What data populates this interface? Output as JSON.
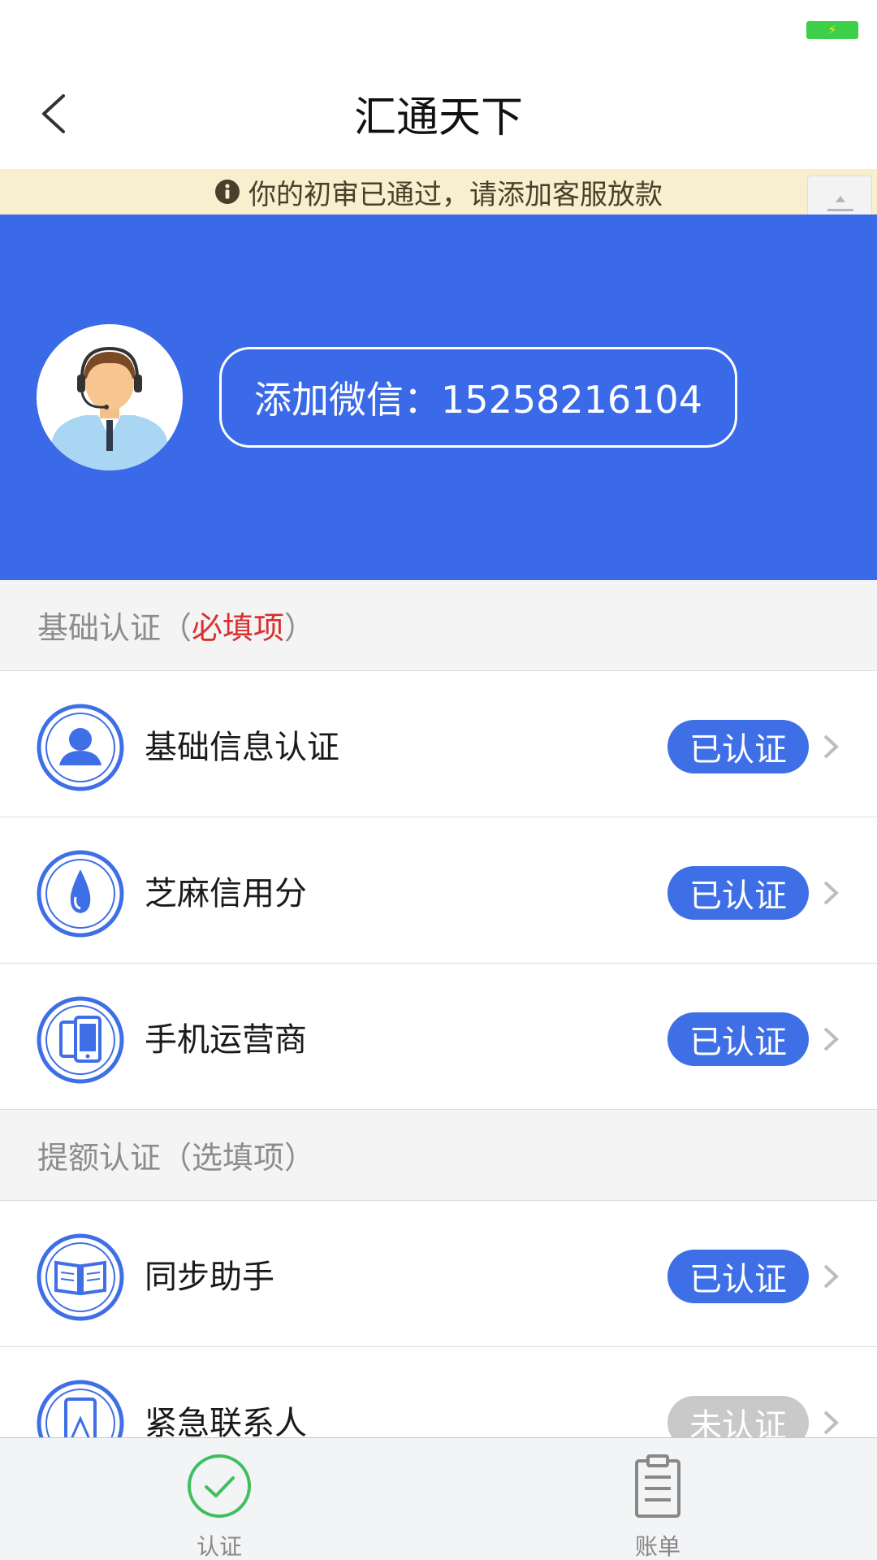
{
  "status_bar": {
    "battery_icon": "battery-charging-icon",
    "battery_color": "#3ecf4a"
  },
  "nav": {
    "title": "汇通天下",
    "back_icon": "back-chevron-icon"
  },
  "notice": {
    "text": "你的初审已通过，请添加客服放款",
    "icon": "info-icon"
  },
  "hero": {
    "background_color": "#3b6ae8",
    "avatar_icon": "customer-service-avatar-icon",
    "wechat_label": "添加微信：15258216104"
  },
  "sections": {
    "basic": {
      "title": "基础认证（",
      "required": "必填项",
      "close": "）"
    },
    "extra": {
      "title": "提额认证（选填项）"
    }
  },
  "items": [
    {
      "label": "基础信息认证",
      "status": "已认证",
      "icon": "person-icon"
    },
    {
      "label": "芝麻信用分",
      "status": "已认证",
      "icon": "sesame-drop-icon"
    },
    {
      "label": "手机运营商",
      "status": "已认证",
      "icon": "mobile-carrier-icon"
    },
    {
      "label": "同步助手",
      "status": "已认证",
      "icon": "book-icon"
    },
    {
      "label": "紧急联系人",
      "status": "未认证",
      "icon": "contact-phone-icon"
    }
  ],
  "colors": {
    "accent": "#3f6fe6",
    "required_red": "#d8302f",
    "badge_off": "#c9c9c9",
    "tab_active": "#3fbf5f"
  },
  "tabs": [
    {
      "label": "认证",
      "icon": "check-circle-icon"
    },
    {
      "label": "账单",
      "icon": "clipboard-icon"
    }
  ]
}
